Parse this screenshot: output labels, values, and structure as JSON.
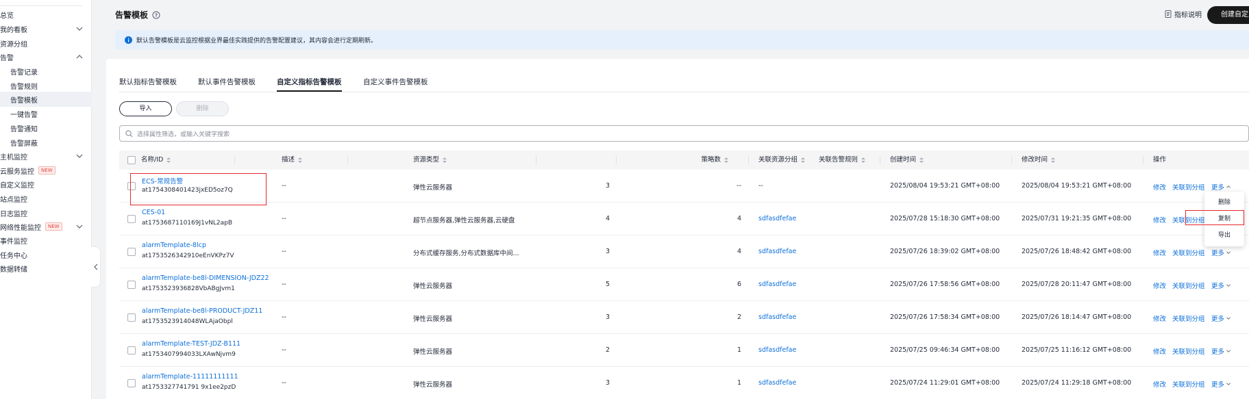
{
  "sidebar": {
    "items": [
      {
        "label": "总览",
        "chevron": "",
        "badge": ""
      },
      {
        "label": "我的看板",
        "chevron": "down",
        "badge": ""
      },
      {
        "label": "资源分组",
        "chevron": "",
        "badge": ""
      },
      {
        "label": "告警",
        "chevron": "up",
        "badge": ""
      },
      {
        "label": "告警记录",
        "chevron": "",
        "badge": "",
        "sub": true
      },
      {
        "label": "告警规则",
        "chevron": "",
        "badge": "",
        "sub": true
      },
      {
        "label": "告警模板",
        "chevron": "",
        "badge": "",
        "sub": true,
        "active": true
      },
      {
        "label": "一键告警",
        "chevron": "",
        "badge": "",
        "sub": true
      },
      {
        "label": "告警通知",
        "chevron": "",
        "badge": "",
        "sub": true
      },
      {
        "label": "告警屏蔽",
        "chevron": "",
        "badge": "",
        "sub": true
      },
      {
        "label": "主机监控",
        "chevron": "down",
        "badge": ""
      },
      {
        "label": "云服务监控",
        "chevron": "",
        "badge": "NEW"
      },
      {
        "label": "自定义监控",
        "chevron": "",
        "badge": ""
      },
      {
        "label": "站点监控",
        "chevron": "",
        "badge": ""
      },
      {
        "label": "日志监控",
        "chevron": "",
        "badge": ""
      },
      {
        "label": "网络性能监控",
        "chevron": "down",
        "badge": "NEW"
      },
      {
        "label": "事件监控",
        "chevron": "",
        "badge": ""
      },
      {
        "label": "任务中心",
        "chevron": "",
        "badge": ""
      },
      {
        "label": "数据转储",
        "chevron": "",
        "badge": ""
      }
    ]
  },
  "header": {
    "title": "告警模板",
    "metric_doc": "指标说明",
    "create_button": "创建自定义告警模板"
  },
  "banner": {
    "text": "默认告警模板是云监控根据业界最佳实践提供的告警配置建议，其内容会进行定期刷新。"
  },
  "tabs": [
    {
      "label": "默认指标告警模板"
    },
    {
      "label": "默认事件告警模板"
    },
    {
      "label": "自定义指标告警模板",
      "active": true
    },
    {
      "label": "自定义事件告警模板"
    }
  ],
  "toolbar": {
    "import_label": "导入",
    "delete_label": "删除"
  },
  "search": {
    "placeholder": "选择属性筛选，或输入关键字搜索"
  },
  "table": {
    "columns": {
      "name": "名称/ID",
      "desc": "描述",
      "resource_type": "资源类型",
      "policy_count": "策略数",
      "linked_rules": "关联告警规则",
      "linked_group": "关联资源分组",
      "created": "创建时间",
      "modified": "修改时间",
      "actions": "操作"
    },
    "action_labels": {
      "edit": "修改",
      "link_group": "关联到分组",
      "more": "更多"
    },
    "rows": [
      {
        "name": "ECS-常规告警",
        "id": "at1754308401423jxED5oz7Q",
        "desc": "--",
        "resource_type": "弹性云服务器",
        "policy_count": "3",
        "linked_rules": "--",
        "linked_group": "--",
        "created": "2025/08/04 19:53:21 GMT+08:00",
        "modified": "2025/08/04 19:53:21 GMT+08:00"
      },
      {
        "name": "CES-01",
        "id": "at1753687110169J1vNL2apB",
        "desc": "--",
        "resource_type": "超节点服务器,弹性云服务器,云硬盘",
        "policy_count": "4",
        "linked_rules": "4",
        "linked_group": "sdfasdfefae",
        "created": "2025/07/28 15:18:30 GMT+08:00",
        "modified": "2025/07/31 19:21:35 GMT+08:00"
      },
      {
        "name": "alarmTemplate-8lcp",
        "id": "at1753526342910eEnVKPz7V",
        "desc": "--",
        "resource_type": "分布式缓存服务,分布式数据库中间...",
        "policy_count": "3",
        "linked_rules": "4",
        "linked_group": "sdfasdfefae",
        "created": "2025/07/26 18:39:02 GMT+08:00",
        "modified": "2025/07/26 18:48:42 GMT+08:00"
      },
      {
        "name": "alarmTemplate-be8l-DIMENSION-JDZ22",
        "id": "at1753523936828VbABgJvm1",
        "desc": "--",
        "resource_type": "弹性云服务器",
        "policy_count": "5",
        "linked_rules": "6",
        "linked_group": "sdfasdfefae",
        "created": "2025/07/26 17:58:56 GMT+08:00",
        "modified": "2025/07/28 20:11:47 GMT+08:00"
      },
      {
        "name": "alarmTemplate-be8l-PRODUCT-JDZ11",
        "id": "at1753523914048WLAjaObpl",
        "desc": "--",
        "resource_type": "弹性云服务器",
        "policy_count": "3",
        "linked_rules": "2",
        "linked_group": "sdfasdfefae",
        "created": "2025/07/26 17:58:34 GMT+08:00",
        "modified": "2025/07/26 18:14:47 GMT+08:00"
      },
      {
        "name": "alarmTemplate-TEST-JDZ-B111",
        "id": "at1753407994033LXAwNjvm9",
        "desc": "--",
        "resource_type": "弹性云服务器",
        "policy_count": "2",
        "linked_rules": "1",
        "linked_group": "sdfasdfefae",
        "created": "2025/07/25 09:46:34 GMT+08:00",
        "modified": "2025/07/25 11:16:12 GMT+08:00"
      },
      {
        "name": "alarmTemplate-11111111111",
        "id": "at1753327741791 9x1ee2pzD",
        "desc": "--",
        "resource_type": "弹性云服务器",
        "policy_count": "3",
        "linked_rules": "1",
        "linked_group": "sdfasdfefae",
        "created": "2025/07/24 11:29:01 GMT+08:00",
        "modified": "2025/07/24 11:29:18 GMT+08:00"
      }
    ]
  },
  "dropdown": {
    "items": [
      "删除",
      "复制",
      "导出"
    ]
  },
  "colors": {
    "link": "#0c6fd9",
    "highlight": "#e5262b",
    "banner_bg": "#e6f0fc",
    "primary_button": "#191919"
  }
}
